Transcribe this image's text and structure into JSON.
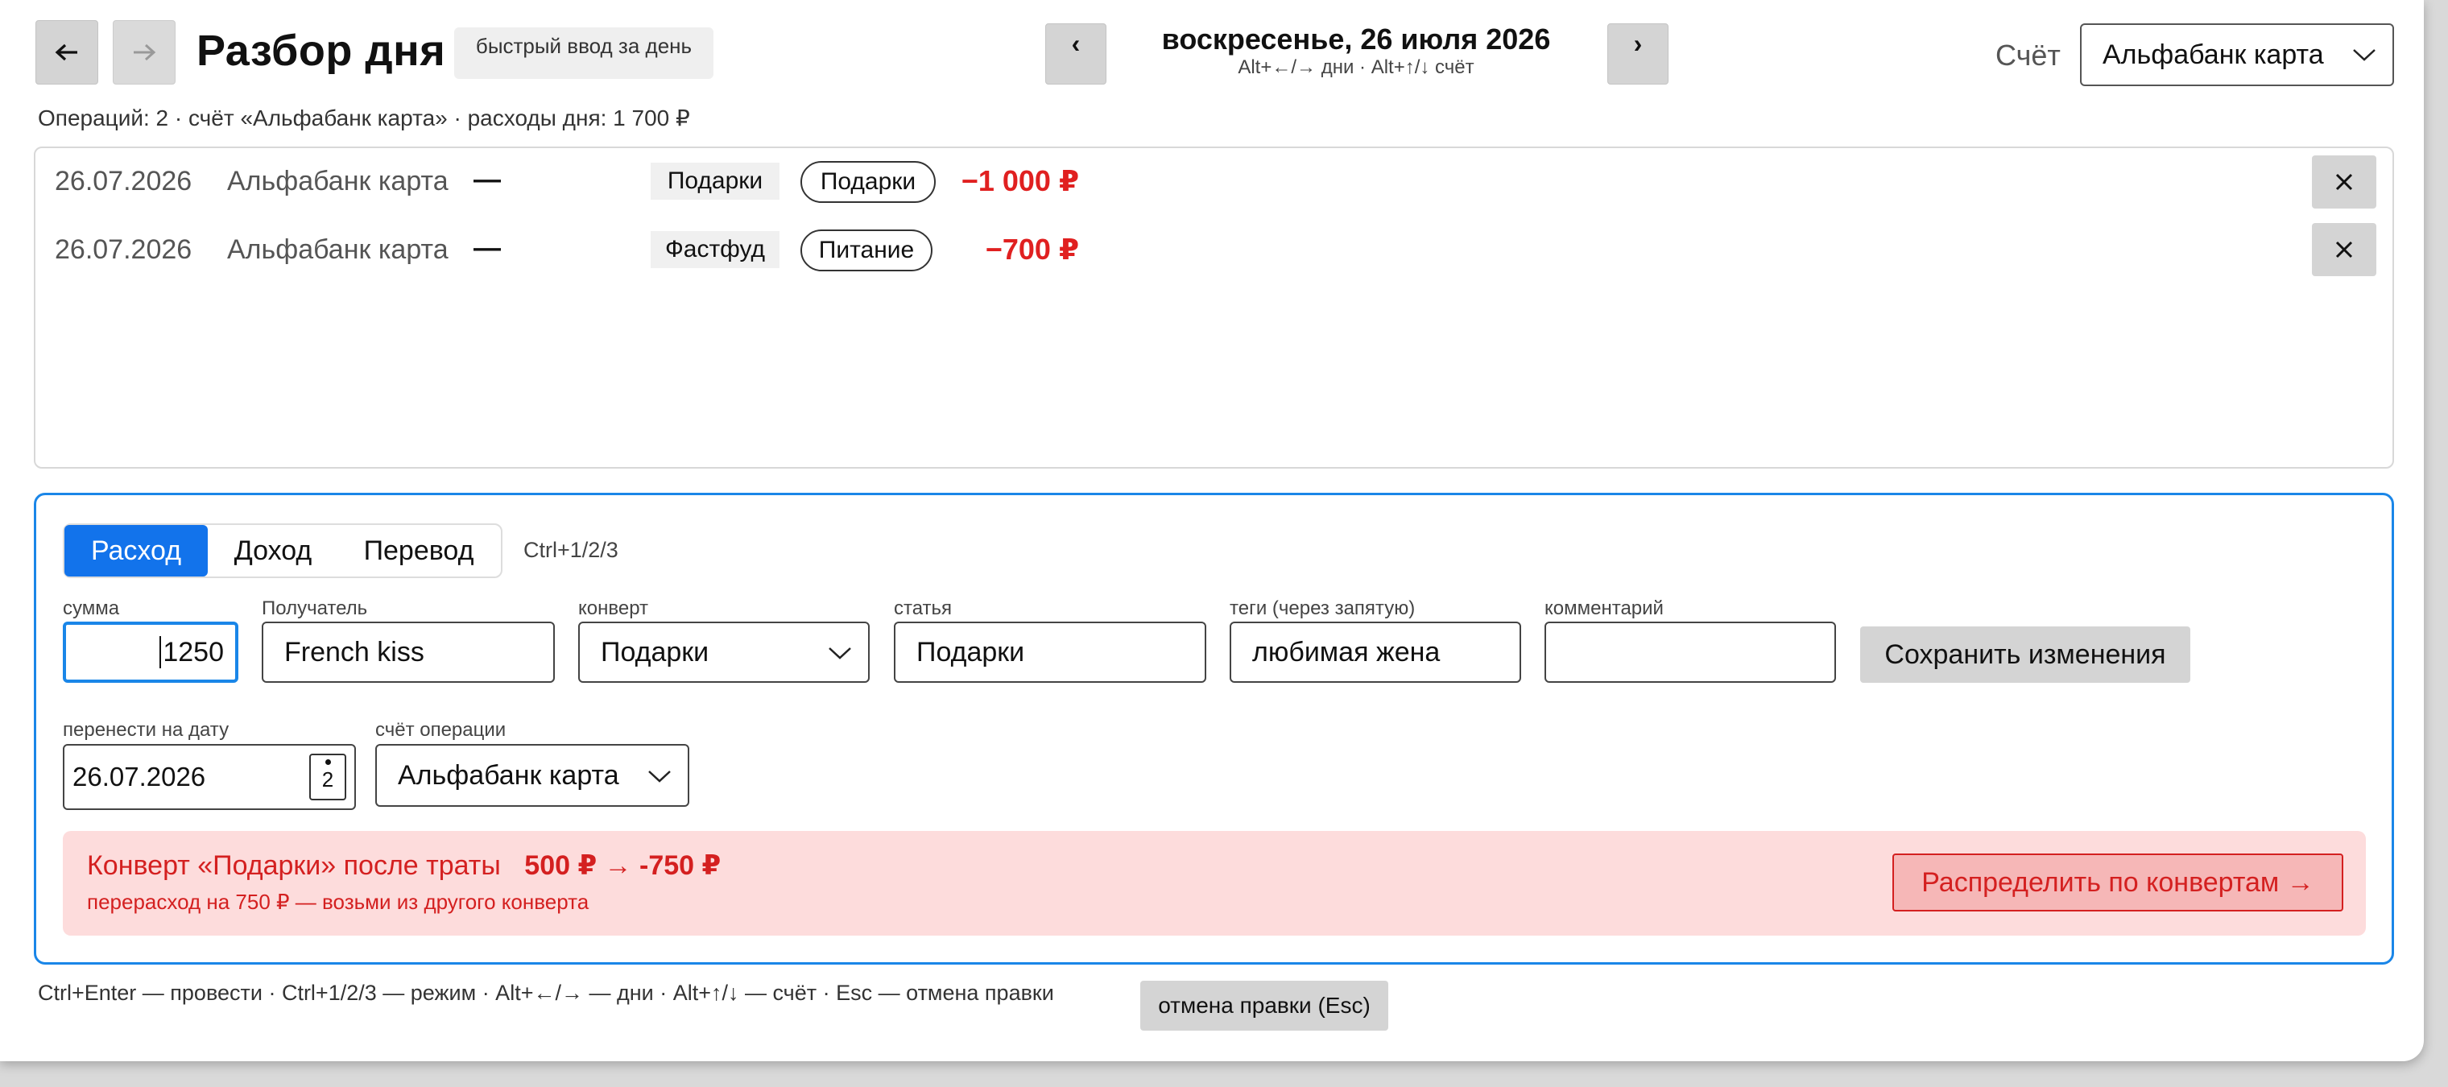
{
  "header": {
    "title": "Разбор дня",
    "badge": "быстрый ввод за день",
    "date": "воскресенье, 26 июля 2026",
    "date_hint": "Alt+←/→ дни · Alt+↑/↓ счёт",
    "prev_day": "‹",
    "next_day": "›",
    "account_label": "Счёт",
    "account_value": "Альфабанк карта"
  },
  "icons": {
    "back": "arrow-left-icon",
    "forward": "arrow-right-icon",
    "remove": "close-icon",
    "dropdown": "chevron-down-icon",
    "calendar": "calendar-icon"
  },
  "summary": "Операций: 2 · счёт «Альфабанк карта» · расходы дня: 1 700 ₽",
  "operations": [
    {
      "date": "26.07.2026",
      "account": "Альфабанк карта",
      "payee": "—",
      "envelope": "Подарки",
      "category": "Подарки",
      "amount": "−1 000 ₽"
    },
    {
      "date": "26.07.2026",
      "account": "Альфабанк карта",
      "payee": "—",
      "envelope": "Фастфуд",
      "category": "Питание",
      "amount": "−700 ₽"
    }
  ],
  "form": {
    "modes": [
      "Расход",
      "Доход",
      "Перевод"
    ],
    "active_mode": "Расход",
    "mode_hint": "Ctrl+1/2/3",
    "fields": {
      "amount": {
        "label": "сумма",
        "value": "1250"
      },
      "payee": {
        "label": "Получатель",
        "value": "French kiss"
      },
      "envelope": {
        "label": "конверт",
        "value": "Подарки"
      },
      "category": {
        "label": "статья",
        "value": "Подарки"
      },
      "tags": {
        "label": "теги (через запятую)",
        "value": "любимая жена"
      },
      "comment": {
        "label": "комментарий",
        "value": ""
      },
      "move_date": {
        "label": "перенести на дату",
        "value": "26.07.2026",
        "calendar_day": "2"
      },
      "op_account": {
        "label": "счёт операции",
        "value": "Альфабанк карта"
      }
    },
    "save_label": "Сохранить изменения"
  },
  "alert": {
    "title": "Конверт «Подарки» после траты",
    "change": "500 ₽ → -750 ₽",
    "subtitle": "перерасход на 750 ₽ — возьми из другого конверта",
    "button": "Распределить по конвертам →"
  },
  "footer": {
    "hint": "Ctrl+Enter — провести · Ctrl+1/2/3 — режим · Alt+←/→ — дни · Alt+↑/↓ — счёт · Esc — отмена правки",
    "cancel_label": "отмена правки (Esc)"
  },
  "colors": {
    "accent": "#1273eb",
    "danger": "#e02020",
    "alert_bg": "#fddcdc"
  }
}
